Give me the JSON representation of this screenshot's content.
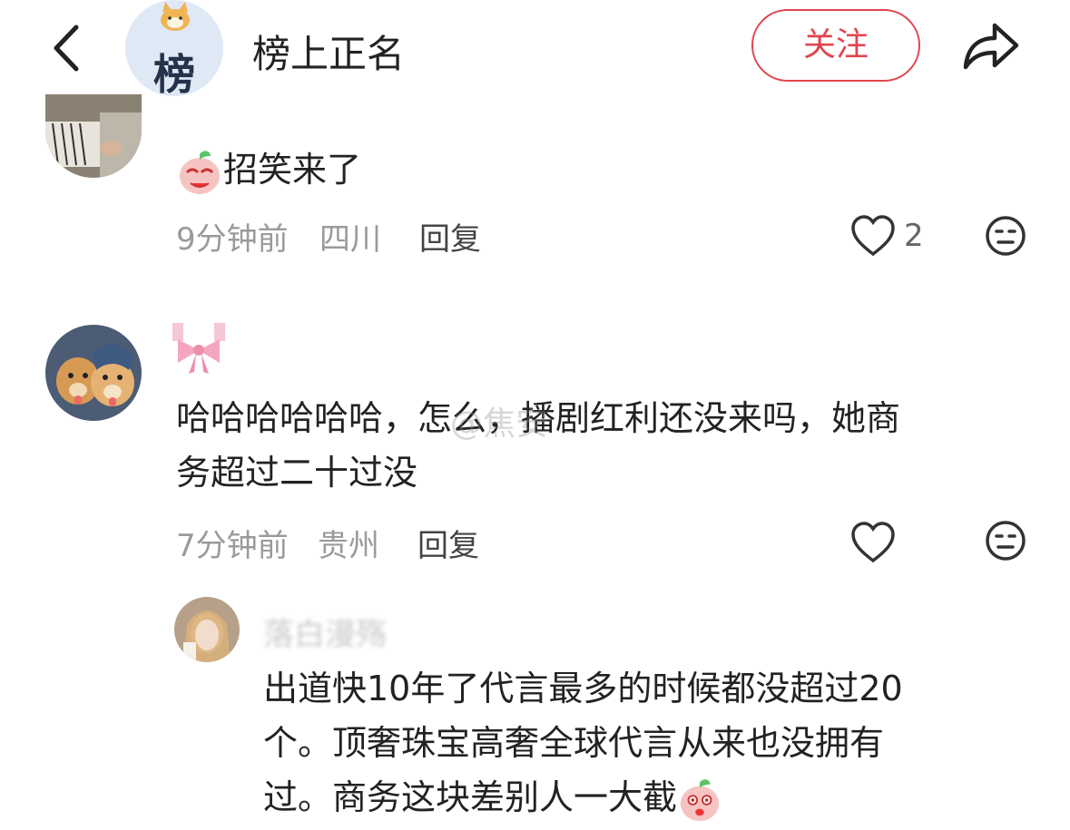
{
  "header": {
    "avatar_char": "榜",
    "title": "榜上正名",
    "follow_label": "关注"
  },
  "comments": [
    {
      "text": "招笑来了",
      "time": "9分钟前",
      "location": "四川",
      "reply_label": "回复",
      "like_count": "2"
    },
    {
      "text_line1": "哈哈哈哈哈哈，怎么，播剧红利还没来吗，她商",
      "text_line2": "务超过二十过没",
      "time": "7分钟前",
      "location": "贵州",
      "reply_label": "回复"
    }
  ],
  "sub_reply": {
    "username": "落白漫殇",
    "line1": "出道快10年了代言最多的时候都没超过20",
    "line2": "个。顶奢珠宝高奢全球代言从来也没拥有",
    "line3": "过。商务这块差别人一大截"
  },
  "watermark": "@焦安",
  "colors": {
    "accent": "#e0454f",
    "meta_gray": "#9a9a9a"
  },
  "icons": [
    "back-icon",
    "share-icon",
    "heart-icon",
    "dislike-face-icon",
    "peach-emoji-icon",
    "bow-icon"
  ]
}
